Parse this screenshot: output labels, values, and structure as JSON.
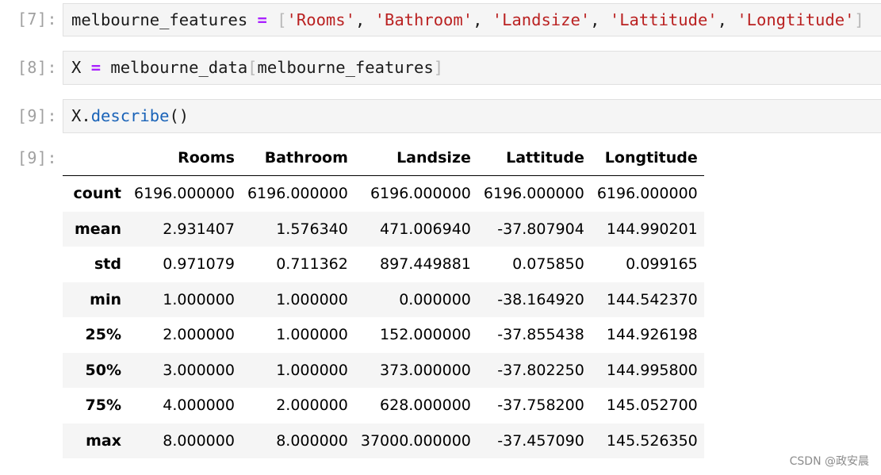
{
  "cells": [
    {
      "prompt": "[7]:",
      "code": {
        "var": "melbourne_features",
        "op": "=",
        "open": "[",
        "items": [
          "'Rooms'",
          "'Bathroom'",
          "'Landsize'",
          "'Lattitude'",
          "'Longtitude'"
        ],
        "sep": ", ",
        "close": "]"
      }
    },
    {
      "prompt": "[8]:",
      "code": {
        "var": "X",
        "op": "=",
        "obj": "melbourne_data",
        "open": "[",
        "arg": "melbourne_features",
        "close": "]"
      }
    },
    {
      "prompt": "[9]:",
      "code": {
        "obj": "X",
        "dot": ".",
        "method": "describe",
        "parens": "()"
      }
    }
  ],
  "output": {
    "prompt": "[9]:",
    "table": {
      "columns": [
        "",
        "Rooms",
        "Bathroom",
        "Landsize",
        "Lattitude",
        "Longtitude"
      ],
      "rows": [
        [
          "count",
          "6196.000000",
          "6196.000000",
          "6196.000000",
          "6196.000000",
          "6196.000000"
        ],
        [
          "mean",
          "2.931407",
          "1.576340",
          "471.006940",
          "-37.807904",
          "144.990201"
        ],
        [
          "std",
          "0.971079",
          "0.711362",
          "897.449881",
          "0.075850",
          "0.099165"
        ],
        [
          "min",
          "1.000000",
          "1.000000",
          "0.000000",
          "-38.164920",
          "144.542370"
        ],
        [
          "25%",
          "2.000000",
          "1.000000",
          "152.000000",
          "-37.855438",
          "144.926198"
        ],
        [
          "50%",
          "3.000000",
          "1.000000",
          "373.000000",
          "-37.802250",
          "144.995800"
        ],
        [
          "75%",
          "4.000000",
          "2.000000",
          "628.000000",
          "-37.758200",
          "145.052700"
        ],
        [
          "max",
          "8.000000",
          "8.000000",
          "37000.000000",
          "-37.457090",
          "145.526350"
        ]
      ]
    }
  },
  "watermark": "CSDN @政安晨",
  "colors": {
    "operator": "#aa22ff",
    "string": "#ba2121",
    "function": "#1a63b8",
    "bracket": "#b8b8b8",
    "prompt": "#a0a0a0",
    "cell_bg": "#f5f5f5"
  }
}
